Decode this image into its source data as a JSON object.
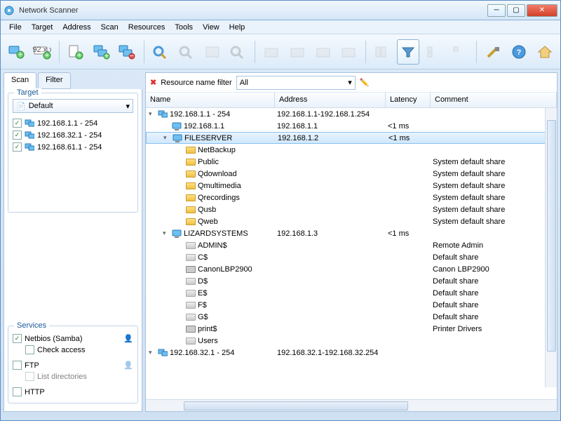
{
  "window": {
    "title": "Network Scanner"
  },
  "menu": [
    "File",
    "Target",
    "Address",
    "Scan",
    "Resources",
    "Tools",
    "View",
    "Help"
  ],
  "tabs": {
    "scan": "Scan",
    "filter": "Filter"
  },
  "target": {
    "label": "Target",
    "combo": "Default",
    "ranges": [
      "192.168.1.1 - 254",
      "192.168.32.1 - 254",
      "192.168.61.1 - 254"
    ]
  },
  "services": {
    "label": "Services",
    "netbios": "Netbios (Samba)",
    "netbios_sub": "Check access",
    "ftp": "FTP",
    "ftp_sub": "List directories",
    "http": "HTTP"
  },
  "filter": {
    "label": "Resource name filter",
    "value": "All"
  },
  "columns": {
    "name": "Name",
    "address": "Address",
    "latency": "Latency",
    "comment": "Comment"
  },
  "tree": [
    {
      "lvl": 0,
      "exp": "▾",
      "icon": "group",
      "name": "192.168.1.1 - 254",
      "addr": "192.168.1.1-192.168.1.254",
      "lat": "",
      "com": ""
    },
    {
      "lvl": 1,
      "exp": "",
      "icon": "pc",
      "name": "192.168.1.1",
      "addr": "192.168.1.1",
      "lat": "<1 ms",
      "com": ""
    },
    {
      "lvl": 1,
      "exp": "▾",
      "icon": "pc",
      "name": "FILESERVER",
      "addr": "192.168.1.2",
      "lat": "<1 ms",
      "com": "",
      "selected": true
    },
    {
      "lvl": 2,
      "exp": "",
      "icon": "folder",
      "name": "NetBackup",
      "addr": "",
      "lat": "",
      "com": ""
    },
    {
      "lvl": 2,
      "exp": "",
      "icon": "folder",
      "name": "Public",
      "addr": "",
      "lat": "",
      "com": "System default share"
    },
    {
      "lvl": 2,
      "exp": "",
      "icon": "folder",
      "name": "Qdownload",
      "addr": "",
      "lat": "",
      "com": "System default share"
    },
    {
      "lvl": 2,
      "exp": "",
      "icon": "folder",
      "name": "Qmultimedia",
      "addr": "",
      "lat": "",
      "com": "System default share"
    },
    {
      "lvl": 2,
      "exp": "",
      "icon": "folder",
      "name": "Qrecordings",
      "addr": "",
      "lat": "",
      "com": "System default share"
    },
    {
      "lvl": 2,
      "exp": "",
      "icon": "folder",
      "name": "Qusb",
      "addr": "",
      "lat": "",
      "com": "System default share"
    },
    {
      "lvl": 2,
      "exp": "",
      "icon": "folder",
      "name": "Qweb",
      "addr": "",
      "lat": "",
      "com": "System default share"
    },
    {
      "lvl": 1,
      "exp": "▾",
      "icon": "pc",
      "name": "LIZARDSYSTEMS",
      "addr": "192.168.1.3",
      "lat": "<1 ms",
      "com": ""
    },
    {
      "lvl": 2,
      "exp": "",
      "icon": "gfolder",
      "name": "ADMIN$",
      "addr": "",
      "lat": "",
      "com": "Remote Admin"
    },
    {
      "lvl": 2,
      "exp": "",
      "icon": "gfolder",
      "name": "C$",
      "addr": "",
      "lat": "",
      "com": "Default share"
    },
    {
      "lvl": 2,
      "exp": "",
      "icon": "printer",
      "name": "CanonLBP2900",
      "addr": "",
      "lat": "",
      "com": "Canon LBP2900"
    },
    {
      "lvl": 2,
      "exp": "",
      "icon": "gfolder",
      "name": "D$",
      "addr": "",
      "lat": "",
      "com": "Default share"
    },
    {
      "lvl": 2,
      "exp": "",
      "icon": "gfolder",
      "name": "E$",
      "addr": "",
      "lat": "",
      "com": "Default share"
    },
    {
      "lvl": 2,
      "exp": "",
      "icon": "gfolder",
      "name": "F$",
      "addr": "",
      "lat": "",
      "com": "Default share"
    },
    {
      "lvl": 2,
      "exp": "",
      "icon": "gfolder",
      "name": "G$",
      "addr": "",
      "lat": "",
      "com": "Default share"
    },
    {
      "lvl": 2,
      "exp": "",
      "icon": "printer",
      "name": "print$",
      "addr": "",
      "lat": "",
      "com": "Printer Drivers"
    },
    {
      "lvl": 2,
      "exp": "",
      "icon": "gfolder",
      "name": "Users",
      "addr": "",
      "lat": "",
      "com": ""
    },
    {
      "lvl": 0,
      "exp": "▾",
      "icon": "group",
      "name": "192.168.32.1 - 254",
      "addr": "192.168.32.1-192.168.32.254",
      "lat": "",
      "com": ""
    }
  ]
}
